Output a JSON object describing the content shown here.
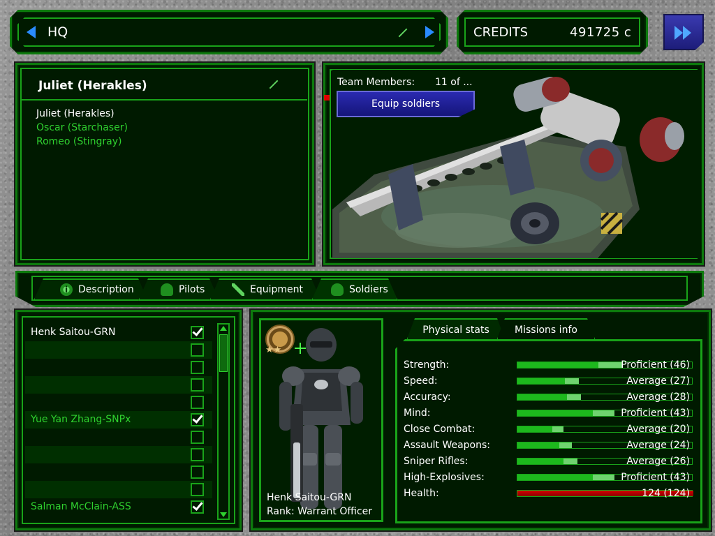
{
  "hq": {
    "label": "HQ"
  },
  "credits": {
    "label": "CREDITS",
    "value": "491725 c"
  },
  "team": {
    "title": "Juliet (Herakles)",
    "members": [
      "Juliet (Herakles)",
      "Oscar (Starchaser)",
      "Romeo (Stingray)"
    ]
  },
  "ship": {
    "team_members_label": "Team Members:",
    "team_members_count": "11 of ...",
    "equip_button": "Equip soldiers"
  },
  "tabs": [
    "Description",
    "Pilots",
    "Equipment",
    "Soldiers"
  ],
  "soldier_list": {
    "rows": [
      {
        "name": "Henk Saitou-GRN",
        "checked": true
      },
      {
        "name": "",
        "checked": false
      },
      {
        "name": "",
        "checked": false
      },
      {
        "name": "",
        "checked": false
      },
      {
        "name": "",
        "checked": false
      },
      {
        "name": "Yue Yan Zhang-SNPx",
        "checked": true
      },
      {
        "name": "",
        "checked": false
      },
      {
        "name": "",
        "checked": false
      },
      {
        "name": "",
        "checked": false
      },
      {
        "name": "",
        "checked": false
      },
      {
        "name": "Salman McClain-ASS",
        "checked": true
      }
    ]
  },
  "soldier_detail": {
    "name": "Henk Saitou-GRN",
    "rank": "Rank: Warrant Officer",
    "tabs": [
      "Physical stats",
      "Missions info"
    ],
    "stats": [
      {
        "label": "Strength:",
        "value": "Proficient (46)",
        "level": 46,
        "level2": 60
      },
      {
        "label": "Speed:",
        "value": "Average (27)",
        "level": 27,
        "level2": 35
      },
      {
        "label": "Accuracy:",
        "value": "Average (28)",
        "level": 28,
        "level2": 36
      },
      {
        "label": "Mind:",
        "value": "Proficient (43)",
        "level": 43,
        "level2": 55
      },
      {
        "label": "Close Combat:",
        "value": "Average (20)",
        "level": 20,
        "level2": 26
      },
      {
        "label": "Assault Weapons:",
        "value": "Average (24)",
        "level": 24,
        "level2": 31
      },
      {
        "label": "Sniper Rifles:",
        "value": "Average (26)",
        "level": 26,
        "level2": 34
      },
      {
        "label": "High-Explosives:",
        "value": "Proficient (43)",
        "level": 43,
        "level2": 55
      },
      {
        "label": "Health:",
        "value": "124 (124)",
        "level": 100,
        "level2": 100
      }
    ]
  },
  "colors": {
    "panel_bg": "#001a00",
    "border_green": "#19a319",
    "text_green": "#2fd12f",
    "accent_blue": "#2a2ab0",
    "health_red": "#d40000"
  }
}
